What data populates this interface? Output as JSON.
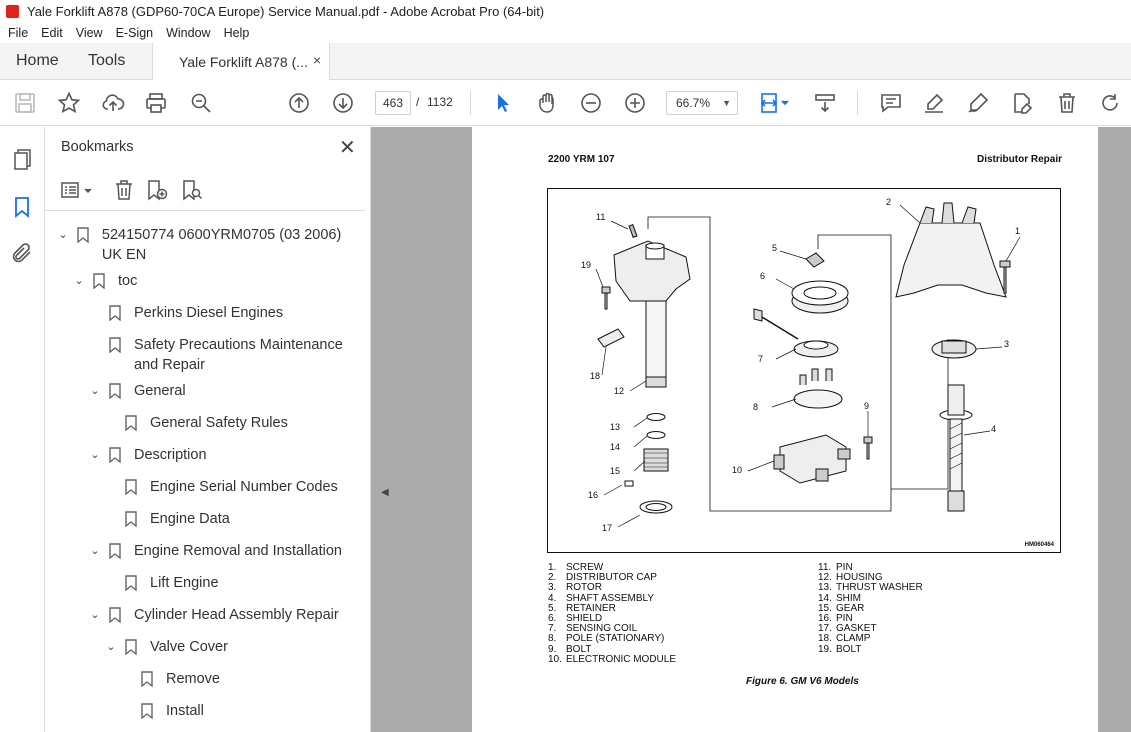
{
  "window": {
    "title": "Yale Forklift A878 (GDP60-70CA Europe) Service Manual.pdf - Adobe Acrobat Pro (64-bit)"
  },
  "menu": [
    "File",
    "Edit",
    "View",
    "E-Sign",
    "Window",
    "Help"
  ],
  "tabs": {
    "home": "Home",
    "tools": "Tools",
    "doc": "Yale Forklift A878 (...",
    "close": "×"
  },
  "toolbar": {
    "page_current": "463",
    "page_separator": "/",
    "page_total": "1132",
    "zoom": "66.7%"
  },
  "bookmarks": {
    "title": "Bookmarks",
    "items": [
      {
        "label": "524150774 0600YRM0705 (03 2006) UK EN",
        "expanded": true
      },
      {
        "label": "toc",
        "expanded": true
      },
      {
        "label": "Perkins Diesel Engines"
      },
      {
        "label": "Safety Precautions Maintenance and Repair"
      },
      {
        "label": "General",
        "expanded": true
      },
      {
        "label": "General Safety Rules"
      },
      {
        "label": "Description",
        "expanded": true
      },
      {
        "label": "Engine Serial Number Codes"
      },
      {
        "label": "Engine Data"
      },
      {
        "label": "Engine Removal and Installation",
        "expanded": true
      },
      {
        "label": "Lift Engine"
      },
      {
        "label": "Cylinder Head Assembly Repair",
        "expanded": true
      },
      {
        "label": "Valve Cover",
        "expanded": true
      },
      {
        "label": "Remove"
      },
      {
        "label": "Install"
      }
    ]
  },
  "document": {
    "header_left": "2200 YRM 107",
    "header_right": "Distributor Repair",
    "figure_code": "HM060464",
    "callouts": [
      "1",
      "2",
      "3",
      "4",
      "5",
      "6",
      "7",
      "8",
      "9",
      "10",
      "11",
      "12",
      "13",
      "14",
      "15",
      "16",
      "17",
      "18",
      "19"
    ],
    "legend_left": [
      {
        "num": "1.",
        "text": "SCREW"
      },
      {
        "num": "2.",
        "text": "DISTRIBUTOR CAP"
      },
      {
        "num": "3.",
        "text": "ROTOR"
      },
      {
        "num": "4.",
        "text": "SHAFT ASSEMBLY"
      },
      {
        "num": "5.",
        "text": "RETAINER"
      },
      {
        "num": "6.",
        "text": "SHIELD"
      },
      {
        "num": "7.",
        "text": "SENSING COIL"
      },
      {
        "num": "8.",
        "text": "POLE (STATIONARY)"
      },
      {
        "num": "9.",
        "text": "BOLT"
      },
      {
        "num": "10.",
        "text": "ELECTRONIC MODULE"
      }
    ],
    "legend_right": [
      {
        "num": "11.",
        "text": "PIN"
      },
      {
        "num": "12.",
        "text": "HOUSING"
      },
      {
        "num": "13.",
        "text": "THRUST WASHER"
      },
      {
        "num": "14.",
        "text": "SHIM"
      },
      {
        "num": "15.",
        "text": "GEAR"
      },
      {
        "num": "16.",
        "text": "PIN"
      },
      {
        "num": "17.",
        "text": "GASKET"
      },
      {
        "num": "18.",
        "text": "CLAMP"
      },
      {
        "num": "19.",
        "text": "BOLT"
      }
    ],
    "caption": "Figure 6.  GM V6 Models"
  },
  "colors": {
    "accent_blue": "#1473e6",
    "pdf_red": "#e0241b",
    "viewer_bg": "#ababab"
  }
}
